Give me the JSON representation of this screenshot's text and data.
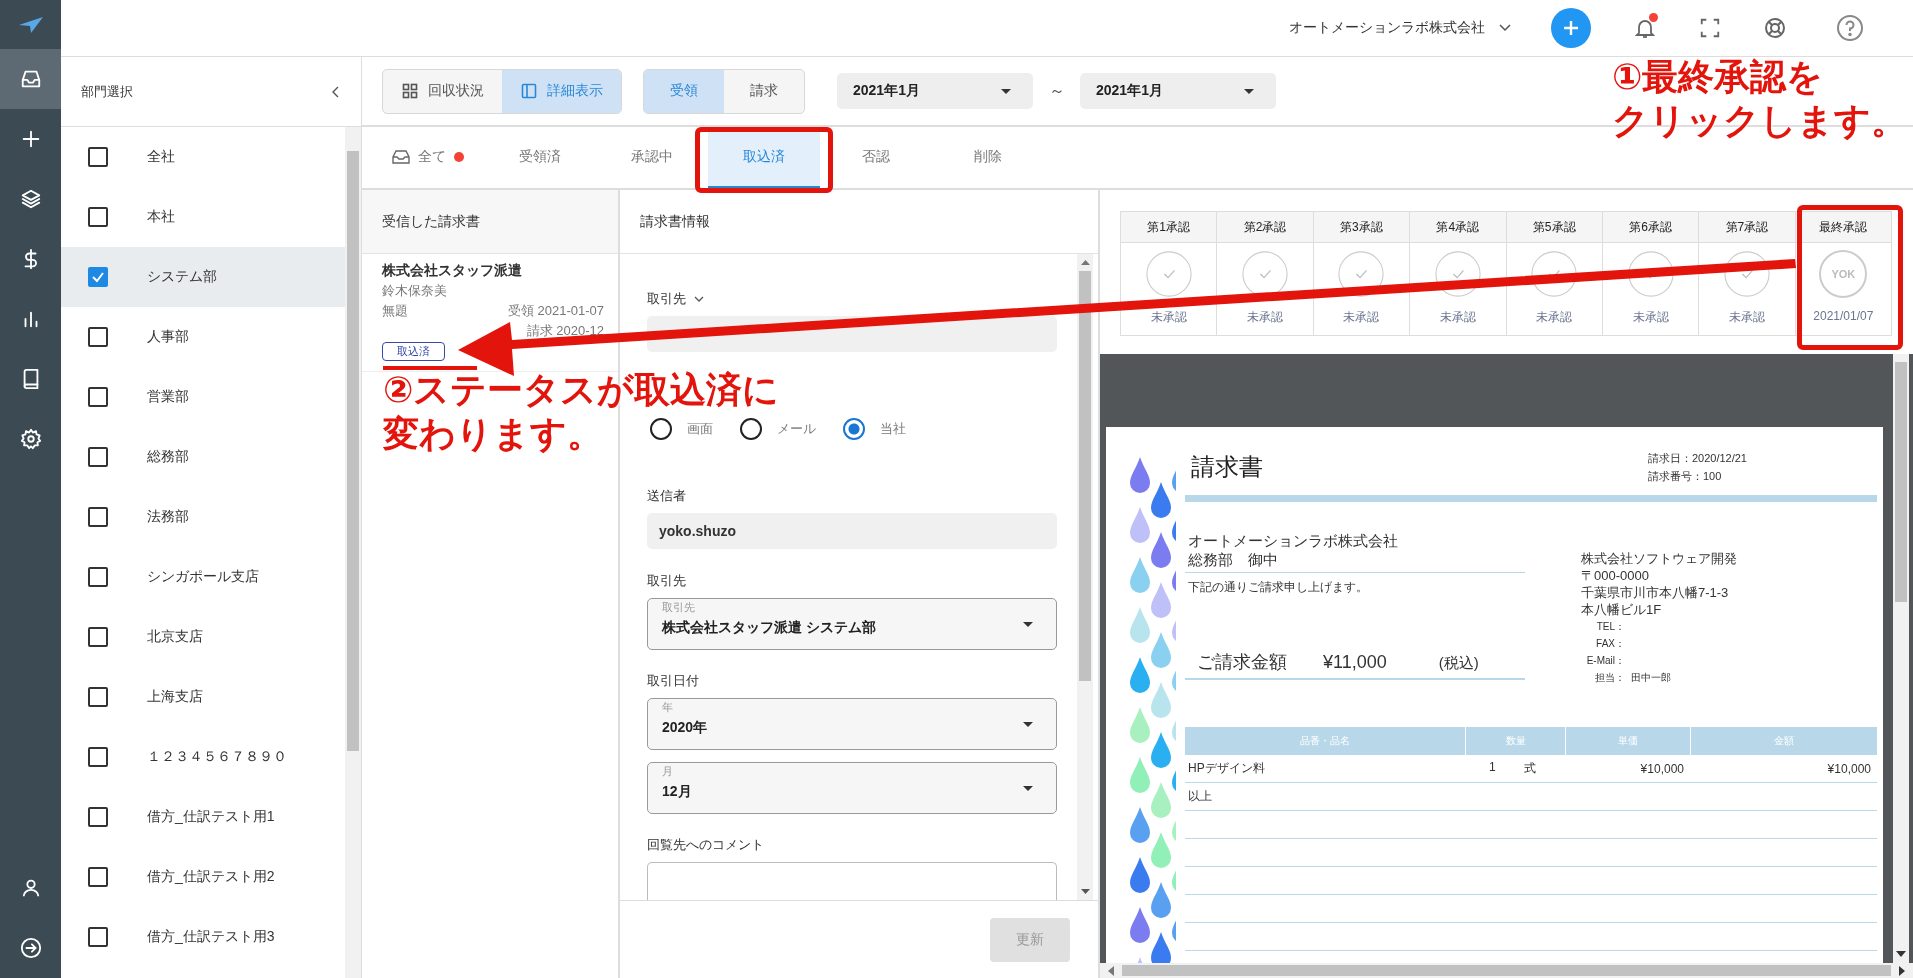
{
  "nav": {
    "items": [
      {
        "selected": true
      },
      {
        "selected": false
      },
      {
        "selected": false
      },
      {
        "selected": false
      },
      {
        "selected": false
      },
      {
        "selected": false
      },
      {
        "selected": false
      }
    ]
  },
  "header": {
    "company": "オートメーションラボ株式会社",
    "has_unread": true
  },
  "departments": {
    "title": "部門選択",
    "items": [
      {
        "label": "全社",
        "checked": false,
        "selected": false
      },
      {
        "label": "本社",
        "checked": false,
        "selected": false
      },
      {
        "label": "システム部",
        "checked": true,
        "selected": true
      },
      {
        "label": "人事部",
        "checked": false,
        "selected": false
      },
      {
        "label": "営業部",
        "checked": false,
        "selected": false
      },
      {
        "label": "総務部",
        "checked": false,
        "selected": false
      },
      {
        "label": "法務部",
        "checked": false,
        "selected": false
      },
      {
        "label": "シンガポール支店",
        "checked": false,
        "selected": false
      },
      {
        "label": "北京支店",
        "checked": false,
        "selected": false
      },
      {
        "label": "上海支店",
        "checked": false,
        "selected": false
      },
      {
        "label": "１２３４５６７８９０",
        "checked": false,
        "selected": false
      },
      {
        "label": "借方_仕訳テスト用1",
        "checked": false,
        "selected": false
      },
      {
        "label": "借方_仕訳テスト用2",
        "checked": false,
        "selected": false
      },
      {
        "label": "借方_仕訳テスト用3",
        "checked": false,
        "selected": false
      }
    ]
  },
  "toolbar": {
    "view_modes": [
      {
        "label": "回収状況",
        "selected": false
      },
      {
        "label": "詳細表示",
        "selected": true
      }
    ],
    "directions": [
      {
        "label": "受領",
        "selected": true
      },
      {
        "label": "請求",
        "selected": false
      }
    ],
    "date_from": "2021年1月",
    "date_separator": "～",
    "date_to": "2021年1月"
  },
  "status_tabs": [
    {
      "label": "全て",
      "has_dot": true,
      "selected": false
    },
    {
      "label": "受領済",
      "has_dot": false,
      "selected": false
    },
    {
      "label": "承認中",
      "has_dot": false,
      "selected": false
    },
    {
      "label": "取込済",
      "has_dot": false,
      "selected": true
    },
    {
      "label": "否認",
      "has_dot": false,
      "selected": false
    },
    {
      "label": "削除",
      "has_dot": false,
      "selected": false
    }
  ],
  "invoice_list": {
    "title": "受信した請求書",
    "items": [
      {
        "company": "株式会社スタッフ派遣",
        "person": "鈴木保奈美",
        "subject": "無題",
        "received": "受領 2021-01-07",
        "billed": "請求 2020-12",
        "status": "取込済"
      }
    ]
  },
  "form": {
    "title": "請求書情報",
    "partner_toggle_label": "取引先",
    "methods": [
      {
        "label": "画面",
        "selected": false
      },
      {
        "label": "メール",
        "selected": false
      },
      {
        "label": "当社",
        "selected": true
      }
    ],
    "sender_label": "送信者",
    "sender": "yoko.shuzo",
    "partner_label": "取引先",
    "partner_field_label": "取引先",
    "partner": "株式会社スタッフ派遣 システム部",
    "date_label": "取引日付",
    "year_field_label": "年",
    "year": "2020年",
    "month_field_label": "月",
    "month": "12月",
    "comment_label": "回覧先へのコメント",
    "update_button": {
      "label": "更新",
      "disabled": true
    }
  },
  "approvals": {
    "steps": [
      {
        "label": "第1承認",
        "kind": "pending",
        "status": "未承認"
      },
      {
        "label": "第2承認",
        "kind": "pending",
        "status": "未承認"
      },
      {
        "label": "第3承認",
        "kind": "pending",
        "status": "未承認"
      },
      {
        "label": "第4承認",
        "kind": "pending",
        "status": "未承認"
      },
      {
        "label": "第5承認",
        "kind": "pending",
        "status": "未承認"
      },
      {
        "label": "第6承認",
        "kind": "pending",
        "status": "未承認"
      },
      {
        "label": "第7承認",
        "kind": "pending",
        "status": "未承認"
      },
      {
        "label": "最終承認",
        "kind": "approved",
        "stamp": "YOK",
        "status": "2021/01/07"
      }
    ]
  },
  "invoice": {
    "title": "請求書",
    "date": "請求日：2020/12/21",
    "number": "請求番号：100",
    "recipient": "オートメーションラボ株式会社",
    "recipient_dept": "総務部　御中",
    "message": "下記の通りご請求申し上げます。",
    "amount_label": "ご請求金額",
    "amount": "¥11,000",
    "tax_note": "(税込)",
    "sender_lines": [
      "株式会社ソフトウェア開発",
      "〒000-0000",
      "千葉県市川市本八幡7-1-3",
      "本八幡ビル1F"
    ],
    "contacts": [
      {
        "label": "TEL："
      },
      {
        "label": "FAX："
      },
      {
        "label": "E-Mail："
      },
      {
        "label": "担当：",
        "value": "田中一郎"
      }
    ],
    "columns": [
      "品番・品名",
      "数量",
      "単価",
      "金額"
    ],
    "rows": [
      {
        "item": "HPデザイン料",
        "qty": "1",
        "unit": "式",
        "price": "¥10,000",
        "amount": "¥10,000"
      },
      {
        "item": "以上"
      }
    ]
  },
  "annotations": [
    {
      "lines": [
        "①最終承認を",
        "クリックします。"
      ]
    },
    {
      "lines": [
        "②ステータスが取込済に",
        "変わります。"
      ]
    }
  ]
}
